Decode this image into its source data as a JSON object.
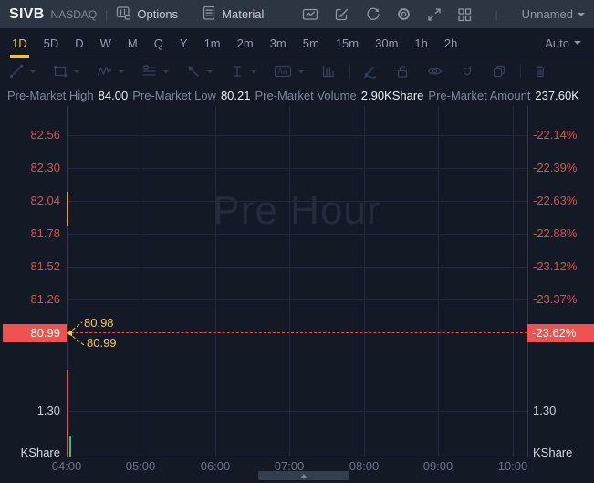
{
  "header": {
    "symbol": "SIVB",
    "exchange": "NASDAQ",
    "separator": "|",
    "options_label": "Options",
    "material_label": "Material",
    "layout_name": "Unnamed"
  },
  "timeframes": {
    "items": [
      "1D",
      "5D",
      "D",
      "W",
      "M",
      "Q",
      "Y",
      "1m",
      "2m",
      "3m",
      "5m",
      "15m",
      "30m",
      "1h",
      "2h"
    ],
    "active": "1D",
    "auto_label": "Auto"
  },
  "premarket": {
    "stats": [
      {
        "label": "Pre-Market High",
        "value": "84.00"
      },
      {
        "label": "Pre-Market Low",
        "value": "80.21"
      },
      {
        "label": "Pre-Market Volume",
        "value": "2.90KShare"
      },
      {
        "label": "Pre-Market Amount",
        "value": "237.60K"
      }
    ]
  },
  "chart_data": {
    "type": "line",
    "session_watermark": "Pre Hour",
    "left_axis_prices": [
      "82.56",
      "82.30",
      "82.04",
      "81.78",
      "81.52",
      "81.26"
    ],
    "right_axis_changes": [
      "-22.14%",
      "-22.39%",
      "-22.63%",
      "-22.88%",
      "-23.12%",
      "-23.37%"
    ],
    "last_price": "80.99",
    "last_change": "-23.62%",
    "price_callout_upper": "80.98",
    "price_callout_lower": "80.99",
    "x_ticks": [
      "04:00",
      "05:00",
      "06:00",
      "07:00",
      "08:00",
      "09:00",
      "10:00"
    ],
    "volume_axis_tick": "1.30",
    "volume_unit_left": "KShare",
    "volume_unit_right": "KShare",
    "candles": [
      {
        "time": "04:00",
        "approx_high": 82.11,
        "approx_low": 81.85,
        "color": "orange"
      }
    ],
    "volume_bars": [
      {
        "near_time": "04:00",
        "approx_kshare": 2.5,
        "color": "red"
      },
      {
        "near_time": "04:00",
        "approx_kshare": 0.6,
        "color": "green"
      }
    ],
    "grid": true,
    "colors": {
      "down_red": "#ef5350",
      "axis_red_text": "#d5534e",
      "callout_yellow": "#f4cd3d",
      "active_tab_yellow": "#f2c230",
      "up_green": "#36c07c",
      "candle_orange": "#e29a33",
      "header_bg": "#2c3542",
      "chart_bg": "#131925"
    }
  },
  "icons": {
    "caret": "▾",
    "expand_arrow": "▲"
  }
}
